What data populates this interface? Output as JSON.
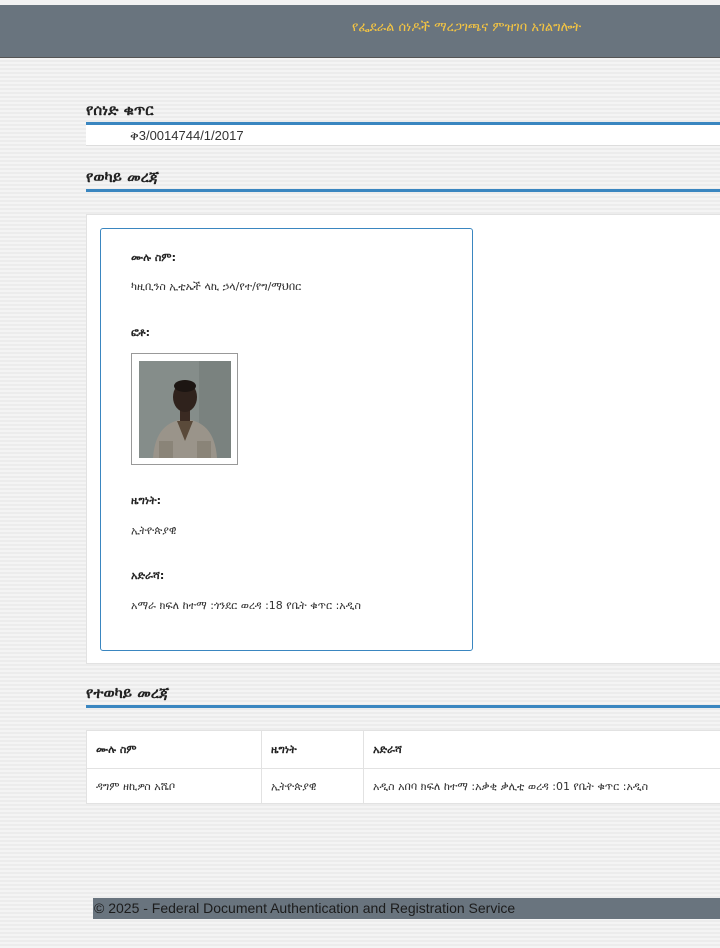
{
  "header": {
    "title": "የፌደራል ሰነዶች ማረጋገጫና ምዝገባ አገልግሎት"
  },
  "document": {
    "section_title": "የሰነድ ቁጥር",
    "number": "ቅ3/0014744/1/2017"
  },
  "principal": {
    "section_title": "የወካይ መረጃ",
    "full_name_label": "ሙሉ ስም:",
    "full_name": "ካዚቢንስ ኢቲኤች ላኪ ኃላ/የተ/የግ/ማህበር",
    "photo_label": "ፎቶ:",
    "nationality_label": "ዜግነት:",
    "nationality": "ኢትዮጵያዊ",
    "address_label": "አድራሻ:",
    "address": "አማራ ክፍለ ከተማ :ጎንደር ወረዳ :18 የቤት ቁጥር :አዲስ"
  },
  "agent": {
    "section_title": "የተወካይ መረጃ",
    "columns": [
      "ሙሉ ስም",
      "ዜግነት",
      "አድራሻ"
    ],
    "rows": [
      [
        "ዳግም ዘኪዎስ አሼቦ",
        "ኢትዮጵያዊ",
        "አዲስ አበባ ክፍለ ከተማ :አቃቂ ቃሊቲ ወረዳ :01 የቤት ቁጥር :አዲስ"
      ]
    ]
  },
  "footer": {
    "text": "© 2025 - Federal Document Authentication and Registration Service"
  },
  "colors": {
    "header_bg": "#69747e",
    "header_text": "#f5c542",
    "accent": "#3a86c0"
  }
}
